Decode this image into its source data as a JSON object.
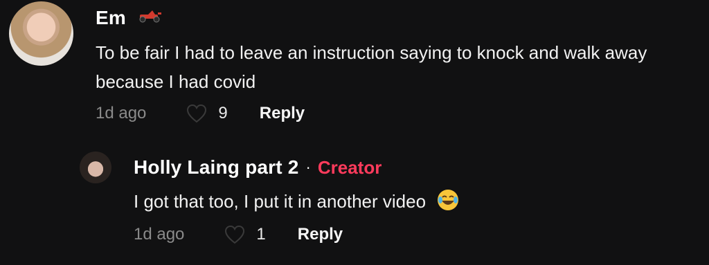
{
  "comment": {
    "author": "Em",
    "author_badge_icon": "race-car-icon",
    "text": "To be fair I had to leave an instruction saying to knock and walk away because I had covid",
    "time": "1d ago",
    "likes": "9",
    "reply_label": "Reply"
  },
  "reply": {
    "author": "Holly Laing part 2",
    "separator": "·",
    "creator_label": "Creator",
    "text": "I got that too, I put it in another video",
    "emoji_icon": "laughing-tears-emoji-icon",
    "time": "1d ago",
    "likes": "1",
    "reply_label": "Reply"
  },
  "colors": {
    "background": "#111112",
    "creator": "#ff3b5c",
    "muted": "#8a8a8a"
  }
}
